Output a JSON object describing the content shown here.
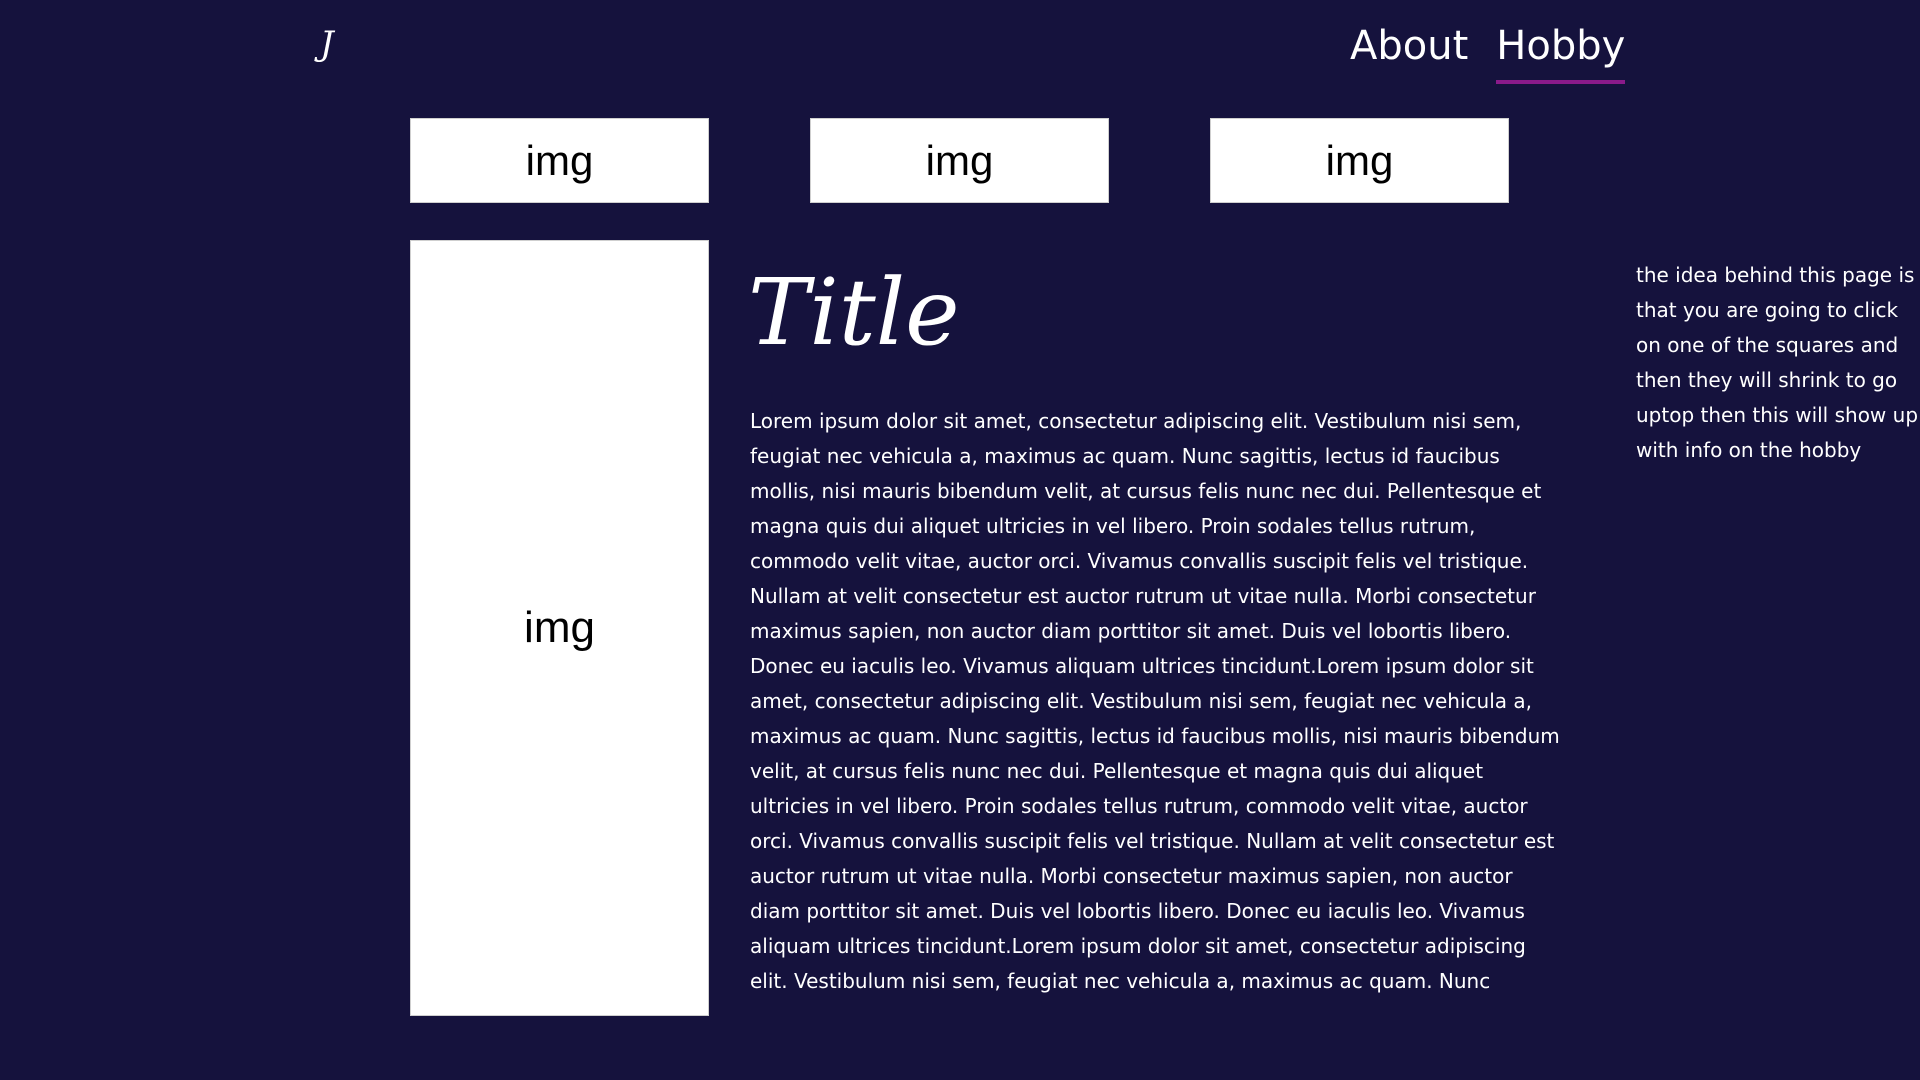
{
  "header": {
    "logo": "J",
    "nav": [
      {
        "label": "About",
        "active": false
      },
      {
        "label": "Hobby",
        "active": true
      }
    ],
    "active_underline_color": "#8a1a8a"
  },
  "thumbnails": [
    "img",
    "img",
    "img"
  ],
  "main": {
    "image_label": "img",
    "title": "Title",
    "body": "Lorem ipsum dolor sit amet, consectetur adipiscing elit. Vestibulum nisi sem, feugiat nec vehicula a, maximus ac quam. Nunc sagittis, lectus id faucibus mollis, nisi mauris bibendum velit, at cursus felis nunc nec dui. Pellentesque et magna quis dui aliquet ultricies in vel libero. Proin sodales tellus rutrum, commodo velit vitae, auctor orci. Vivamus convallis suscipit felis vel tristique. Nullam at velit consectetur est auctor rutrum ut vitae nulla. Morbi consectetur maximus sapien, non auctor diam porttitor sit amet. Duis vel lobortis libero. Donec eu iaculis leo. Vivamus aliquam ultrices tincidunt.Lorem ipsum dolor sit amet, consectetur adipiscing elit. Vestibulum nisi sem, feugiat nec vehicula a, maximus ac quam. Nunc sagittis, lectus id faucibus mollis, nisi mauris bibendum velit, at cursus felis nunc nec dui. Pellentesque et magna quis dui aliquet ultricies in vel libero. Proin sodales tellus rutrum, commodo velit vitae, auctor orci. Vivamus convallis suscipit felis vel tristique. Nullam at velit consectetur est auctor rutrum ut vitae nulla. Morbi consectetur maximus sapien, non auctor diam porttitor sit amet. Duis vel lobortis libero. Donec eu iaculis leo. Vivamus aliquam ultrices tincidunt.Lorem ipsum dolor sit amet, consectetur adipiscing elit. Vestibulum nisi sem, feugiat nec vehicula a, maximus ac quam. Nunc sagittis, lectus id faucibus mollis, nisi mauris"
  },
  "side_note": "the idea behind this page is that you are going to click on one of the squares and then they will shrink to go uptop then this will show up with info on the hobby",
  "colors": {
    "background": "#15123d",
    "text": "#ffffff",
    "card": "#ffffff"
  }
}
